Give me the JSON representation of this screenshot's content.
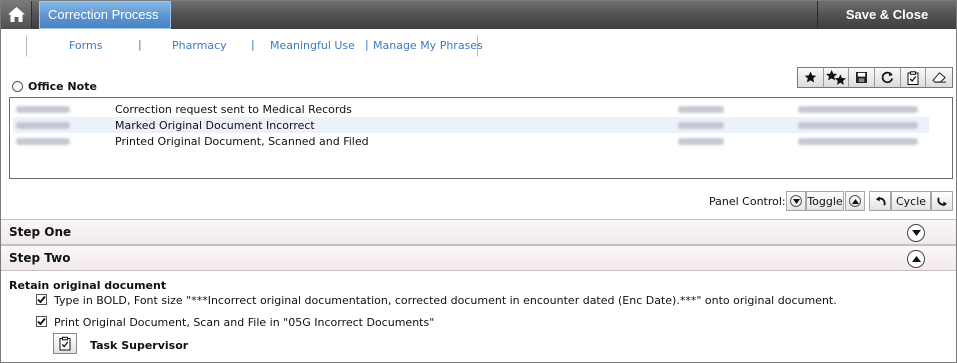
{
  "header": {
    "home_icon": "home-icon",
    "active_tab": "Correction Process",
    "save_close": "Save & Close"
  },
  "nav": {
    "links": [
      "Forms",
      "Pharmacy",
      "Meaningful Use",
      "Manage My Phrases"
    ],
    "separator": "|"
  },
  "note_type": {
    "label": "Office Note"
  },
  "toolbar": {
    "icons": [
      "star-icon",
      "stars-icon",
      "save-icon",
      "refresh-icon",
      "clipboard-check-icon",
      "eraser-icon"
    ]
  },
  "notes": [
    {
      "text": "Correction request sent to Medical Records",
      "selected": false
    },
    {
      "text": "Marked Original Document Incorrect",
      "selected": true
    },
    {
      "text": "Printed Original Document, Scanned and Filed",
      "selected": false
    }
  ],
  "panel_control": {
    "label": "Panel Control:",
    "toggle": "Toggle",
    "cycle": "Cycle"
  },
  "steps": [
    {
      "title": "Step One",
      "state": "collapsed"
    },
    {
      "title": "Step Two",
      "state": "expanded"
    }
  ],
  "step_two": {
    "section_title": "Retain original document",
    "items": [
      {
        "text": "Type in BOLD, Font size \"***Incorrect original documentation, corrected document in encounter dated (Enc Date).***\"  onto original document.",
        "checked": true
      },
      {
        "text": "Print Original Document, Scan and File in \"05G Incorrect Documents\"",
        "checked": true
      }
    ],
    "task": {
      "label": "Task Supervisor",
      "icon": "clipboard-check-icon"
    }
  },
  "colors": {
    "accent": "#5a93cf",
    "link": "#3d79c2",
    "topbar": "#4f4f4f",
    "step_bg": "#f4edf1"
  }
}
